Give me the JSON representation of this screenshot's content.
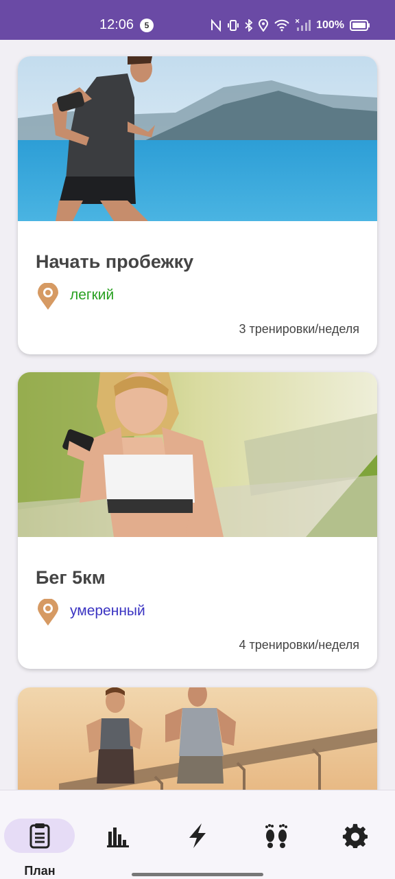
{
  "status_bar": {
    "time": "12:06",
    "notification_count": "5",
    "battery": "100%",
    "background": "#6a4aa5",
    "icons": [
      "nfc-icon",
      "vibrate-icon",
      "bluetooth-icon",
      "location-icon",
      "wifi-icon",
      "signal-icon",
      "battery-icon"
    ]
  },
  "plans": [
    {
      "title": "Начать пробежку",
      "level": "легкий",
      "level_color": "#28a020",
      "frequency": "3 тренировки/неделя",
      "image": "runner-man-lake-photo"
    },
    {
      "title": "Бег 5км",
      "level": "умеренный",
      "level_color": "#3a33c2",
      "frequency": "4 тренировки/неделя",
      "image": "woman-runner-phone-photo"
    },
    {
      "title": "",
      "level": "",
      "frequency": "",
      "image": "couple-running-sunset-photo"
    }
  ],
  "bottom_nav": {
    "items": [
      {
        "label": "План",
        "icon": "clipboard-icon",
        "active": true
      },
      {
        "label": "",
        "icon": "bar-chart-icon",
        "active": false
      },
      {
        "label": "",
        "icon": "lightning-icon",
        "active": false
      },
      {
        "label": "",
        "icon": "footprints-icon",
        "active": false
      },
      {
        "label": "",
        "icon": "gear-icon",
        "active": false
      }
    ],
    "active_color": "#e6dcf6"
  }
}
